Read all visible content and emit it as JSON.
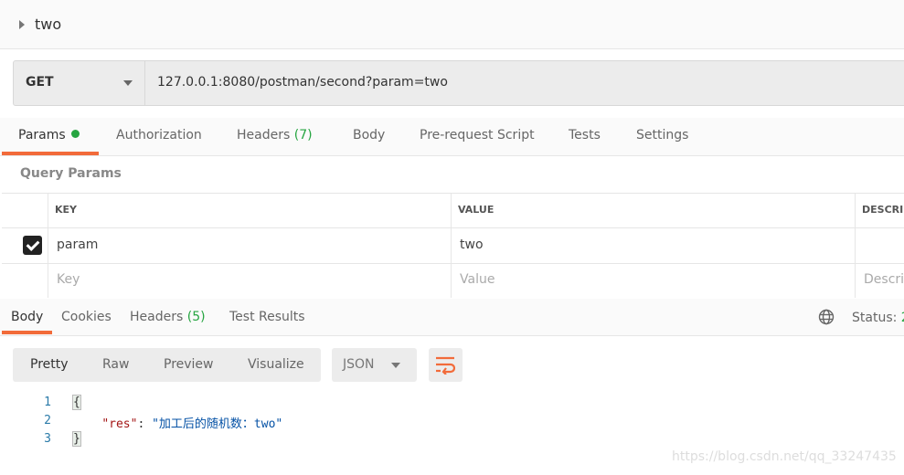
{
  "request": {
    "name": "two",
    "method": "GET",
    "url": "127.0.0.1:8080/postman/second?param=two"
  },
  "request_tabs": [
    {
      "label": "Params",
      "active": true,
      "dot": true
    },
    {
      "label": "Authorization"
    },
    {
      "label": "Headers",
      "count": "(7)"
    },
    {
      "label": "Body"
    },
    {
      "label": "Pre-request Script"
    },
    {
      "label": "Tests"
    },
    {
      "label": "Settings"
    }
  ],
  "query_params": {
    "title": "Query Params",
    "headers": [
      "KEY",
      "VALUE",
      "DESCRI"
    ],
    "rows": [
      {
        "checked": true,
        "key": "param",
        "value": "two",
        "description": ""
      }
    ],
    "placeholders": {
      "key": "Key",
      "value": "Value",
      "description": "Descri"
    }
  },
  "response_tabs": [
    {
      "label": "Body",
      "active": true
    },
    {
      "label": "Cookies"
    },
    {
      "label": "Headers",
      "count": "(5)"
    },
    {
      "label": "Test Results"
    }
  ],
  "status": {
    "label": "Status:",
    "value": "2"
  },
  "view_modes": [
    "Pretty",
    "Raw",
    "Preview",
    "Visualize"
  ],
  "format": "JSON",
  "code": {
    "lines": [
      "1",
      "2",
      "3"
    ],
    "open": "{",
    "key": "\"res\"",
    "colon": ": ",
    "value": "\"加工后的随机数：two\"",
    "close": "}"
  },
  "watermark": "https://blog.csdn.net/qq_33247435",
  "colors": {
    "accent": "#f26b3a",
    "green": "#26a541"
  }
}
